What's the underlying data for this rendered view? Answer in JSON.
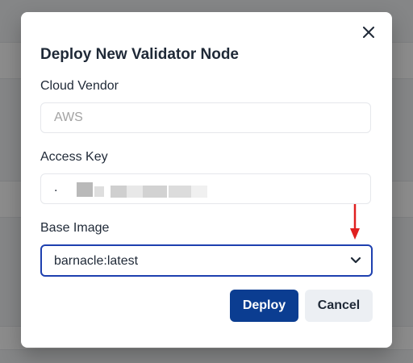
{
  "modal": {
    "title": "Deploy New Validator Node",
    "close_icon": "close-icon"
  },
  "form": {
    "cloud_vendor": {
      "label": "Cloud Vendor",
      "placeholder": "AWS"
    },
    "access_key": {
      "label": "Access Key",
      "value": "."
    },
    "base_image": {
      "label": "Base Image",
      "selected": "barnacle:latest",
      "icon": "chevron-down-icon"
    }
  },
  "buttons": {
    "deploy_label": "Deploy",
    "cancel_label": "Cancel"
  },
  "annotation": {
    "icon": "red-arrow-down-icon",
    "color": "#e02020"
  },
  "colors": {
    "primary": "#0b3d91",
    "focus_border": "#1e40af",
    "secondary_bg": "#eceff3"
  }
}
